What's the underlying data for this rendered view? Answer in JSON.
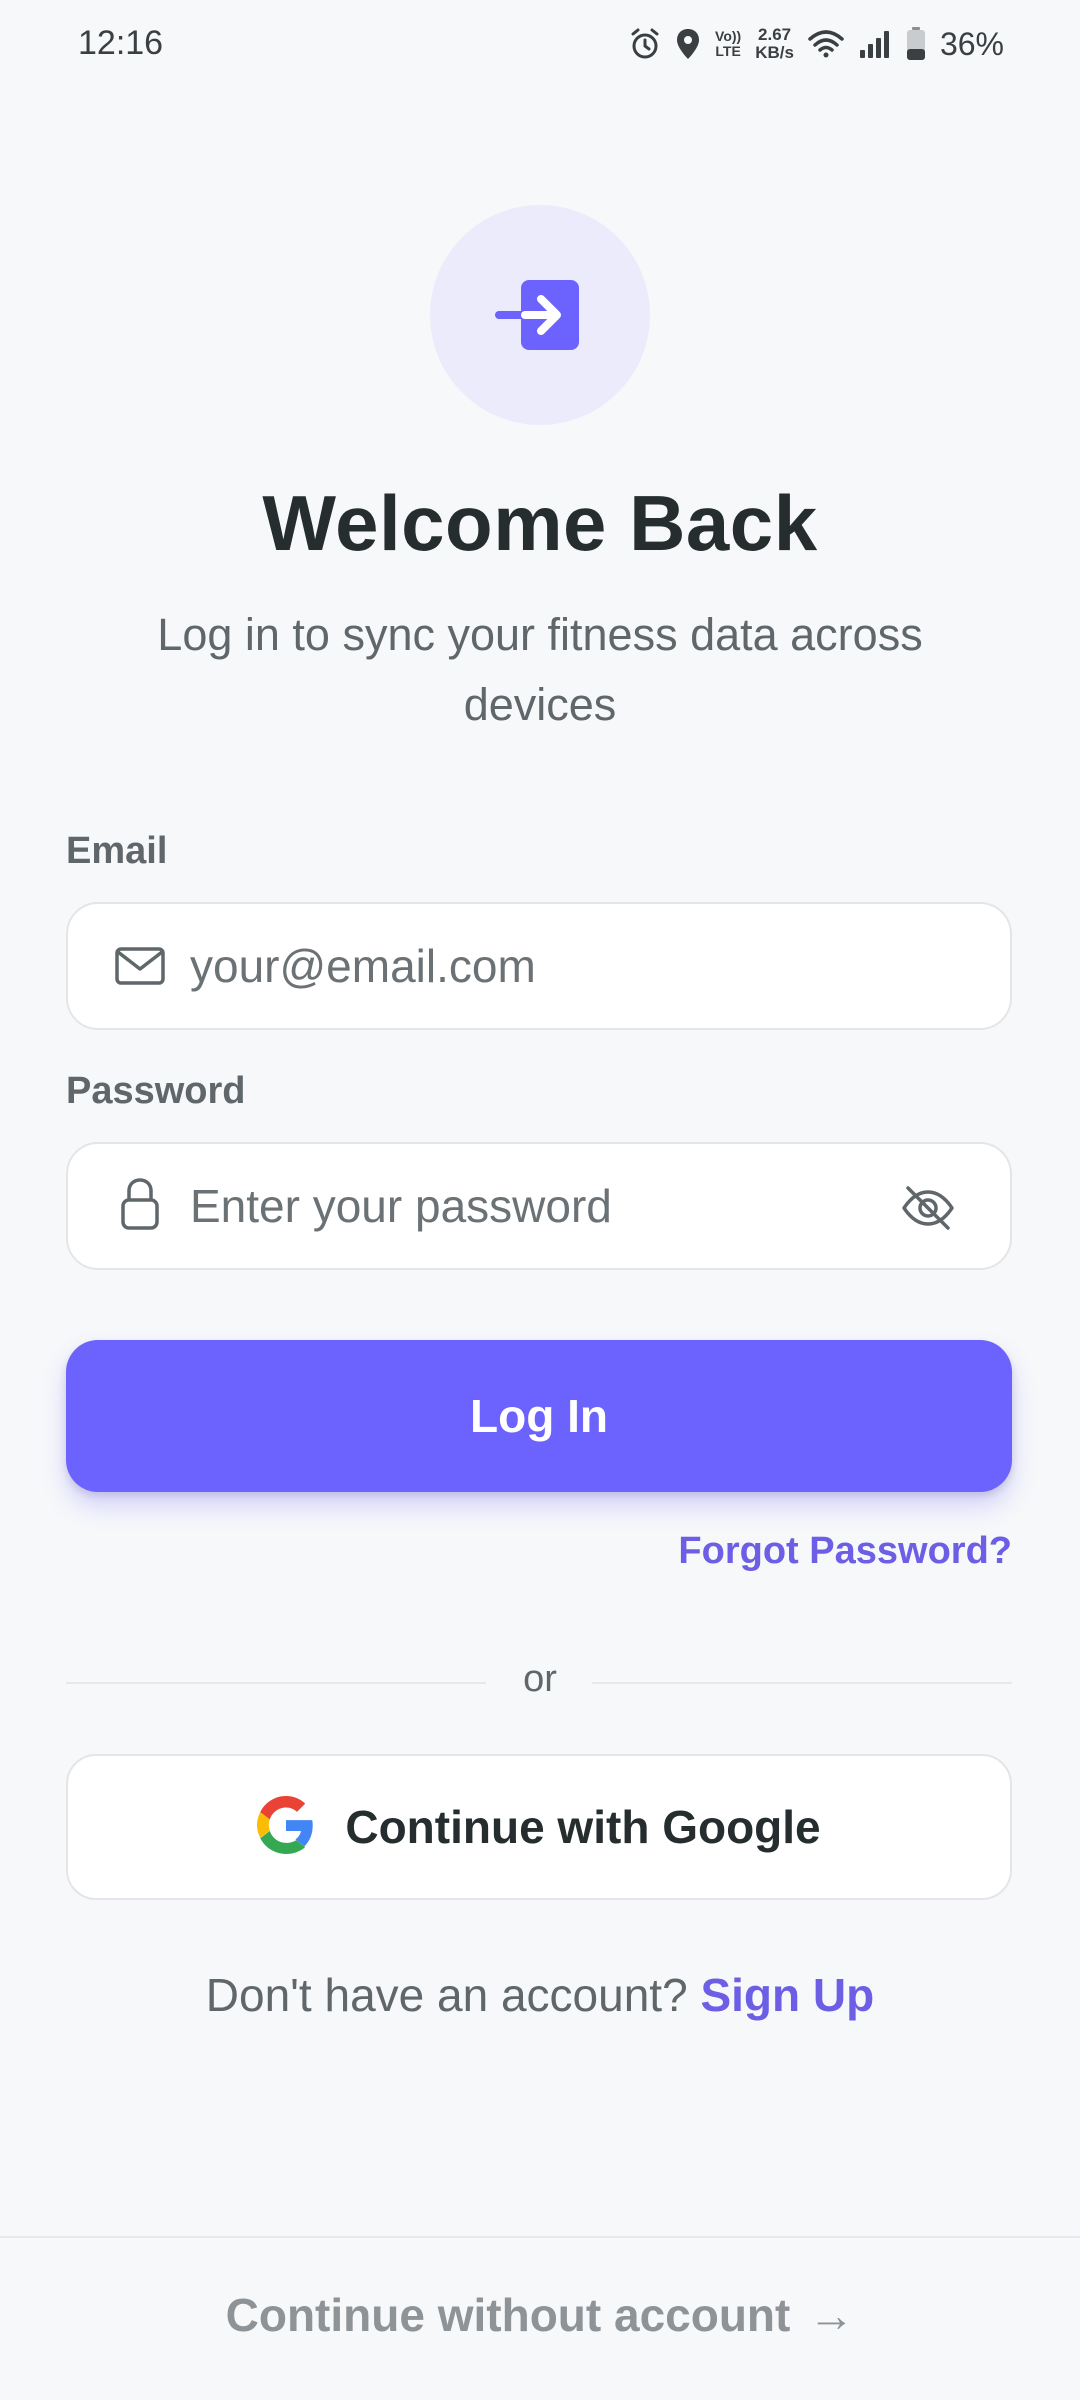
{
  "status_bar": {
    "time": "12:16",
    "volte_top": "Vo))",
    "volte_bottom": "LTE",
    "net_speed_value": "2.67",
    "net_speed_unit": "KB/s",
    "battery_percent": "36%",
    "battery_level": 0.36,
    "icons": [
      "alarm-icon",
      "location-icon",
      "volte-icon",
      "wifi-icon",
      "signal-icon",
      "battery-icon"
    ]
  },
  "hero": {
    "icon": "login-arrow-icon",
    "title": "Welcome Back",
    "subtitle": "Log in to sync your fitness data across devices"
  },
  "form": {
    "email": {
      "label": "Email",
      "placeholder": "your@email.com",
      "value": "",
      "icon": "mail-icon"
    },
    "password": {
      "label": "Password",
      "placeholder": "Enter your password",
      "value": "",
      "icon": "lock-icon",
      "toggle_icon": "eye-off-icon"
    },
    "login_label": "Log In",
    "forgot_label": "Forgot Password?"
  },
  "divider_text": "or",
  "google": {
    "label": "Continue with Google",
    "icon": "google-icon"
  },
  "signup": {
    "prompt": "Don't have an account?",
    "link": "Sign Up"
  },
  "continue_without": {
    "label": "Continue without account",
    "arrow": "→"
  },
  "colors": {
    "accent": "#6c63ff",
    "background": "#f7f8fa",
    "hero_circle": "#ecebfc",
    "link": "#6c5fe6"
  }
}
